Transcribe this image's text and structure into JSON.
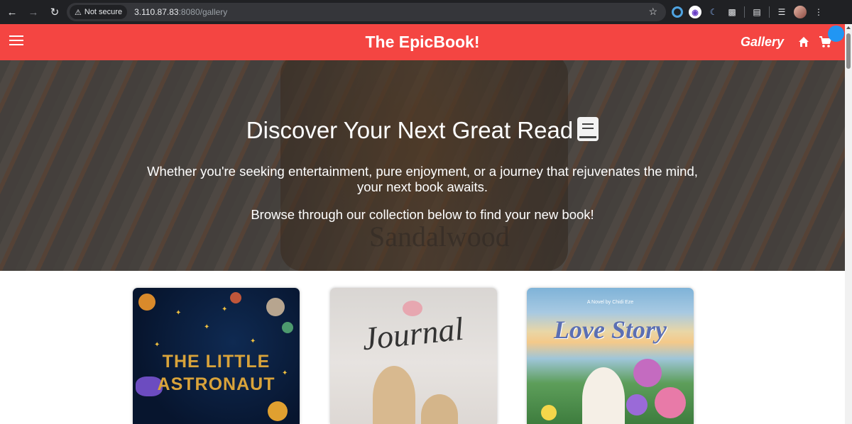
{
  "browser": {
    "security_label": "Not secure",
    "url_host": "3.110.87.83",
    "url_rest": ":8080/gallery",
    "icons": [
      "back-arrow-icon",
      "forward-arrow-icon",
      "reload-icon",
      "warning-icon",
      "star-icon",
      "extension-icons",
      "profile-avatar"
    ]
  },
  "header": {
    "title": "The EpicBook!",
    "gallery_link": "Gallery",
    "color": "#f44542",
    "notification_color": "#2196f3"
  },
  "hero": {
    "title": "Discover Your Next Great Read",
    "subtitle_line1": "Whether you're seeking entertainment, pure enjoyment, or a journey that rejuvenates the mind,",
    "subtitle_line2": "your next book awaits.",
    "browse_text": "Browse through our collection below to find your new book!",
    "background_label": "Sandalwood"
  },
  "books": [
    {
      "title_line1": "THE LITTLE",
      "title_line2": "ASTRONAUT"
    },
    {
      "title": "Journal"
    },
    {
      "author_line": "A Novel by Chidi Eze",
      "title": "Love Story"
    }
  ]
}
